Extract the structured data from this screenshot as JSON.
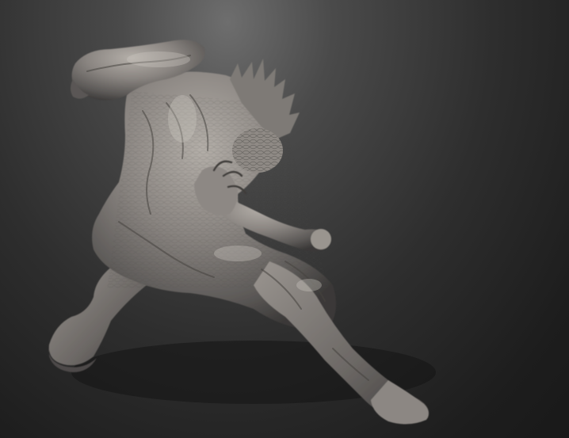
{
  "scene": {
    "background_top": "#6e6e6e",
    "background_bottom": "#191919",
    "model_material_base": "#7a7775",
    "model_material_highlight": "#b9b4ae",
    "model_material_shadow": "#2c2a29"
  }
}
